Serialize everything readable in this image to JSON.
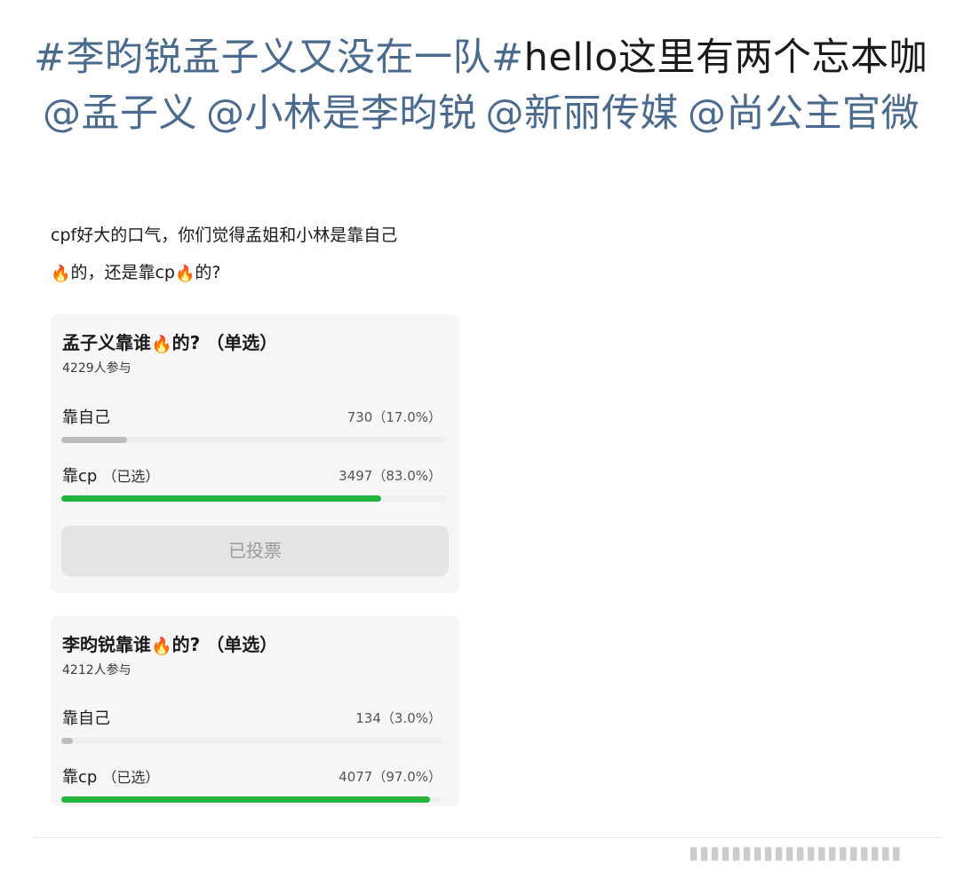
{
  "post": {
    "topic": "#李昀锐孟子义又没在一队#",
    "text_a": "hello这里有两个忘本咖",
    "mentions": [
      "@孟子义",
      "@小林是李昀锐",
      "@新丽传媒",
      "@尚公主官微"
    ]
  },
  "repost": {
    "part1": "cpf好大的口气，你们觉得孟姐和小林是靠自己",
    "part2": "的，还是靠cp",
    "part3": "的?",
    "fire_icon": "fire-icon"
  },
  "polls": [
    {
      "title_a": "孟子义靠谁",
      "title_b": "的? （单选）",
      "participants": "4229人参与",
      "options": [
        {
          "label": "靠自己",
          "selected_tag": "",
          "stat": "730（17.0%）",
          "fraction": 0.17,
          "color": "#bdbdbd"
        },
        {
          "label": "靠cp",
          "selected_tag": "（已选）",
          "stat": "3497（83.0%）",
          "fraction": 0.83,
          "color": "#22b43c"
        }
      ],
      "button_label": "已投票"
    },
    {
      "title_a": "李昀锐靠谁",
      "title_b": "的? （单选）",
      "participants": "4212人参与",
      "options": [
        {
          "label": "靠自己",
          "selected_tag": "",
          "stat": "134（3.0%）",
          "fraction": 0.03,
          "color": "#bdbdbd"
        },
        {
          "label": "靠cp",
          "selected_tag": "（已选）",
          "stat": "4077（97.0%）",
          "fraction": 0.97,
          "color": "#22b43c"
        }
      ]
    }
  ],
  "colors": {
    "link": "#4a6a8e",
    "accent_green": "#22b43c",
    "card_bg": "#f6f6f6"
  }
}
